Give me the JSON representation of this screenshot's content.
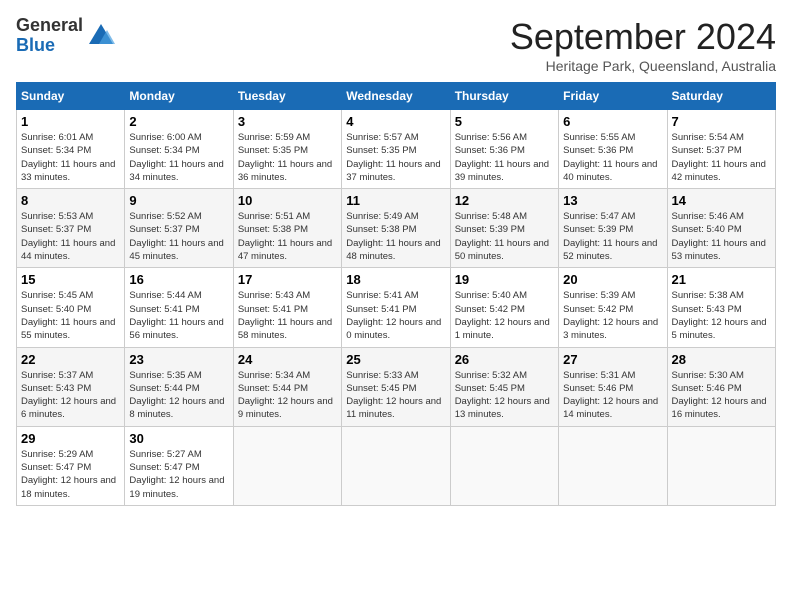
{
  "logo": {
    "general": "General",
    "blue": "Blue"
  },
  "title": "September 2024",
  "location": "Heritage Park, Queensland, Australia",
  "weekdays": [
    "Sunday",
    "Monday",
    "Tuesday",
    "Wednesday",
    "Thursday",
    "Friday",
    "Saturday"
  ],
  "weeks": [
    [
      {
        "day": "1",
        "sunrise": "6:01 AM",
        "sunset": "5:34 PM",
        "daylight": "11 hours and 33 minutes."
      },
      {
        "day": "2",
        "sunrise": "6:00 AM",
        "sunset": "5:34 PM",
        "daylight": "11 hours and 34 minutes."
      },
      {
        "day": "3",
        "sunrise": "5:59 AM",
        "sunset": "5:35 PM",
        "daylight": "11 hours and 36 minutes."
      },
      {
        "day": "4",
        "sunrise": "5:57 AM",
        "sunset": "5:35 PM",
        "daylight": "11 hours and 37 minutes."
      },
      {
        "day": "5",
        "sunrise": "5:56 AM",
        "sunset": "5:36 PM",
        "daylight": "11 hours and 39 minutes."
      },
      {
        "day": "6",
        "sunrise": "5:55 AM",
        "sunset": "5:36 PM",
        "daylight": "11 hours and 40 minutes."
      },
      {
        "day": "7",
        "sunrise": "5:54 AM",
        "sunset": "5:37 PM",
        "daylight": "11 hours and 42 minutes."
      }
    ],
    [
      {
        "day": "8",
        "sunrise": "5:53 AM",
        "sunset": "5:37 PM",
        "daylight": "11 hours and 44 minutes."
      },
      {
        "day": "9",
        "sunrise": "5:52 AM",
        "sunset": "5:37 PM",
        "daylight": "11 hours and 45 minutes."
      },
      {
        "day": "10",
        "sunrise": "5:51 AM",
        "sunset": "5:38 PM",
        "daylight": "11 hours and 47 minutes."
      },
      {
        "day": "11",
        "sunrise": "5:49 AM",
        "sunset": "5:38 PM",
        "daylight": "11 hours and 48 minutes."
      },
      {
        "day": "12",
        "sunrise": "5:48 AM",
        "sunset": "5:39 PM",
        "daylight": "11 hours and 50 minutes."
      },
      {
        "day": "13",
        "sunrise": "5:47 AM",
        "sunset": "5:39 PM",
        "daylight": "11 hours and 52 minutes."
      },
      {
        "day": "14",
        "sunrise": "5:46 AM",
        "sunset": "5:40 PM",
        "daylight": "11 hours and 53 minutes."
      }
    ],
    [
      {
        "day": "15",
        "sunrise": "5:45 AM",
        "sunset": "5:40 PM",
        "daylight": "11 hours and 55 minutes."
      },
      {
        "day": "16",
        "sunrise": "5:44 AM",
        "sunset": "5:41 PM",
        "daylight": "11 hours and 56 minutes."
      },
      {
        "day": "17",
        "sunrise": "5:43 AM",
        "sunset": "5:41 PM",
        "daylight": "11 hours and 58 minutes."
      },
      {
        "day": "18",
        "sunrise": "5:41 AM",
        "sunset": "5:41 PM",
        "daylight": "12 hours and 0 minutes."
      },
      {
        "day": "19",
        "sunrise": "5:40 AM",
        "sunset": "5:42 PM",
        "daylight": "12 hours and 1 minute."
      },
      {
        "day": "20",
        "sunrise": "5:39 AM",
        "sunset": "5:42 PM",
        "daylight": "12 hours and 3 minutes."
      },
      {
        "day": "21",
        "sunrise": "5:38 AM",
        "sunset": "5:43 PM",
        "daylight": "12 hours and 5 minutes."
      }
    ],
    [
      {
        "day": "22",
        "sunrise": "5:37 AM",
        "sunset": "5:43 PM",
        "daylight": "12 hours and 6 minutes."
      },
      {
        "day": "23",
        "sunrise": "5:35 AM",
        "sunset": "5:44 PM",
        "daylight": "12 hours and 8 minutes."
      },
      {
        "day": "24",
        "sunrise": "5:34 AM",
        "sunset": "5:44 PM",
        "daylight": "12 hours and 9 minutes."
      },
      {
        "day": "25",
        "sunrise": "5:33 AM",
        "sunset": "5:45 PM",
        "daylight": "12 hours and 11 minutes."
      },
      {
        "day": "26",
        "sunrise": "5:32 AM",
        "sunset": "5:45 PM",
        "daylight": "12 hours and 13 minutes."
      },
      {
        "day": "27",
        "sunrise": "5:31 AM",
        "sunset": "5:46 PM",
        "daylight": "12 hours and 14 minutes."
      },
      {
        "day": "28",
        "sunrise": "5:30 AM",
        "sunset": "5:46 PM",
        "daylight": "12 hours and 16 minutes."
      }
    ],
    [
      {
        "day": "29",
        "sunrise": "5:29 AM",
        "sunset": "5:47 PM",
        "daylight": "12 hours and 18 minutes."
      },
      {
        "day": "30",
        "sunrise": "5:27 AM",
        "sunset": "5:47 PM",
        "daylight": "12 hours and 19 minutes."
      },
      null,
      null,
      null,
      null,
      null
    ]
  ],
  "labels": {
    "sunrise": "Sunrise:",
    "sunset": "Sunset:",
    "daylight": "Daylight:"
  }
}
